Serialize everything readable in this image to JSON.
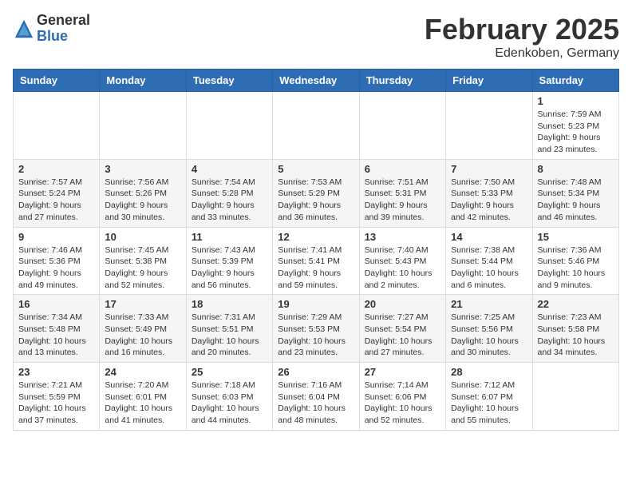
{
  "header": {
    "logo_general": "General",
    "logo_blue": "Blue",
    "month_title": "February 2025",
    "location": "Edenkoben, Germany"
  },
  "calendar": {
    "weekdays": [
      "Sunday",
      "Monday",
      "Tuesday",
      "Wednesday",
      "Thursday",
      "Friday",
      "Saturday"
    ],
    "weeks": [
      [
        {
          "day": "",
          "info": ""
        },
        {
          "day": "",
          "info": ""
        },
        {
          "day": "",
          "info": ""
        },
        {
          "day": "",
          "info": ""
        },
        {
          "day": "",
          "info": ""
        },
        {
          "day": "",
          "info": ""
        },
        {
          "day": "1",
          "info": "Sunrise: 7:59 AM\nSunset: 5:23 PM\nDaylight: 9 hours\nand 23 minutes."
        }
      ],
      [
        {
          "day": "2",
          "info": "Sunrise: 7:57 AM\nSunset: 5:24 PM\nDaylight: 9 hours\nand 27 minutes."
        },
        {
          "day": "3",
          "info": "Sunrise: 7:56 AM\nSunset: 5:26 PM\nDaylight: 9 hours\nand 30 minutes."
        },
        {
          "day": "4",
          "info": "Sunrise: 7:54 AM\nSunset: 5:28 PM\nDaylight: 9 hours\nand 33 minutes."
        },
        {
          "day": "5",
          "info": "Sunrise: 7:53 AM\nSunset: 5:29 PM\nDaylight: 9 hours\nand 36 minutes."
        },
        {
          "day": "6",
          "info": "Sunrise: 7:51 AM\nSunset: 5:31 PM\nDaylight: 9 hours\nand 39 minutes."
        },
        {
          "day": "7",
          "info": "Sunrise: 7:50 AM\nSunset: 5:33 PM\nDaylight: 9 hours\nand 42 minutes."
        },
        {
          "day": "8",
          "info": "Sunrise: 7:48 AM\nSunset: 5:34 PM\nDaylight: 9 hours\nand 46 minutes."
        }
      ],
      [
        {
          "day": "9",
          "info": "Sunrise: 7:46 AM\nSunset: 5:36 PM\nDaylight: 9 hours\nand 49 minutes."
        },
        {
          "day": "10",
          "info": "Sunrise: 7:45 AM\nSunset: 5:38 PM\nDaylight: 9 hours\nand 52 minutes."
        },
        {
          "day": "11",
          "info": "Sunrise: 7:43 AM\nSunset: 5:39 PM\nDaylight: 9 hours\nand 56 minutes."
        },
        {
          "day": "12",
          "info": "Sunrise: 7:41 AM\nSunset: 5:41 PM\nDaylight: 9 hours\nand 59 minutes."
        },
        {
          "day": "13",
          "info": "Sunrise: 7:40 AM\nSunset: 5:43 PM\nDaylight: 10 hours\nand 2 minutes."
        },
        {
          "day": "14",
          "info": "Sunrise: 7:38 AM\nSunset: 5:44 PM\nDaylight: 10 hours\nand 6 minutes."
        },
        {
          "day": "15",
          "info": "Sunrise: 7:36 AM\nSunset: 5:46 PM\nDaylight: 10 hours\nand 9 minutes."
        }
      ],
      [
        {
          "day": "16",
          "info": "Sunrise: 7:34 AM\nSunset: 5:48 PM\nDaylight: 10 hours\nand 13 minutes."
        },
        {
          "day": "17",
          "info": "Sunrise: 7:33 AM\nSunset: 5:49 PM\nDaylight: 10 hours\nand 16 minutes."
        },
        {
          "day": "18",
          "info": "Sunrise: 7:31 AM\nSunset: 5:51 PM\nDaylight: 10 hours\nand 20 minutes."
        },
        {
          "day": "19",
          "info": "Sunrise: 7:29 AM\nSunset: 5:53 PM\nDaylight: 10 hours\nand 23 minutes."
        },
        {
          "day": "20",
          "info": "Sunrise: 7:27 AM\nSunset: 5:54 PM\nDaylight: 10 hours\nand 27 minutes."
        },
        {
          "day": "21",
          "info": "Sunrise: 7:25 AM\nSunset: 5:56 PM\nDaylight: 10 hours\nand 30 minutes."
        },
        {
          "day": "22",
          "info": "Sunrise: 7:23 AM\nSunset: 5:58 PM\nDaylight: 10 hours\nand 34 minutes."
        }
      ],
      [
        {
          "day": "23",
          "info": "Sunrise: 7:21 AM\nSunset: 5:59 PM\nDaylight: 10 hours\nand 37 minutes."
        },
        {
          "day": "24",
          "info": "Sunrise: 7:20 AM\nSunset: 6:01 PM\nDaylight: 10 hours\nand 41 minutes."
        },
        {
          "day": "25",
          "info": "Sunrise: 7:18 AM\nSunset: 6:03 PM\nDaylight: 10 hours\nand 44 minutes."
        },
        {
          "day": "26",
          "info": "Sunrise: 7:16 AM\nSunset: 6:04 PM\nDaylight: 10 hours\nand 48 minutes."
        },
        {
          "day": "27",
          "info": "Sunrise: 7:14 AM\nSunset: 6:06 PM\nDaylight: 10 hours\nand 52 minutes."
        },
        {
          "day": "28",
          "info": "Sunrise: 7:12 AM\nSunset: 6:07 PM\nDaylight: 10 hours\nand 55 minutes."
        },
        {
          "day": "",
          "info": ""
        }
      ]
    ]
  }
}
